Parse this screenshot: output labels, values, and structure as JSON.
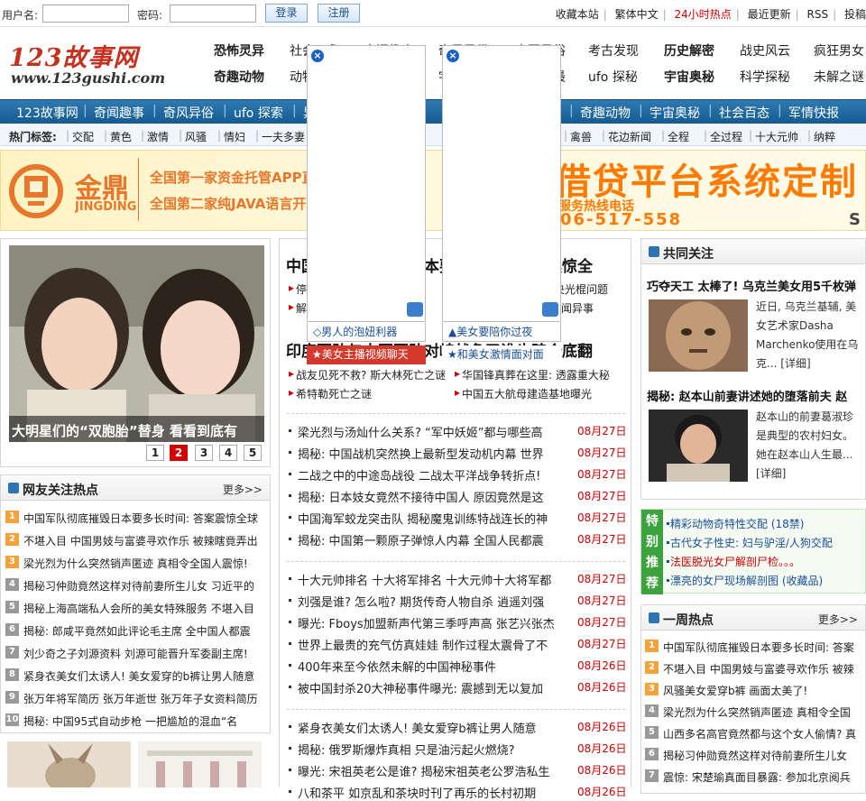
{
  "top": {
    "username_label": "用户名:",
    "password_label": "密码:",
    "login_button": "登录",
    "register_button": "注册",
    "links": [
      "收藏本站",
      "繁体中文",
      "24小时热点",
      "最近更新",
      "RSS",
      "投稿"
    ],
    "accent": "#cc0000"
  },
  "logo": {
    "name": "123故事网",
    "url": "www.123gushi.com"
  },
  "categories": {
    "row1": [
      "恐怖灵异",
      "社会万象",
      "奇闻趣事",
      "奇风异俗",
      "中国风俗",
      "考古发现",
      "历史解密",
      "战史风云",
      "疯狂男女"
    ],
    "row2": [
      "奇趣动物",
      "动物世界",
      "人物传奇",
      "宇宙之谜",
      "世界之最",
      "ufo 探秘",
      "宇宙奥秘",
      "科学探秘",
      "未解之谜"
    ]
  },
  "nav": [
    "123故事网",
    "奇闻趣事",
    "奇风异俗",
    "ufo 探索",
    "异国风情",
    "奇趣动物",
    "宇宙奥秘",
    "社会百态",
    "军情快报"
  ],
  "tags": {
    "label": "热门标签:",
    "items": [
      "交配",
      "黄色",
      "激情",
      "风骚",
      "情妇",
      "一夫多妻",
      "禽兽",
      "花边新闻",
      "全程",
      "全过程",
      "十大元帅",
      "纳粹"
    ]
  },
  "banner": {
    "brand_cn": "金鼎",
    "brand_en": "JINGDING",
    "line1": "全国第一家资金托管APP直接交易",
    "line2": "全国第二家纯JAVA语言开发系统",
    "headline": "借贷平台系统定制",
    "hotline_label": "服务热线电话",
    "phone": "06-517-558",
    "corner": "S",
    "colors": {
      "orange": "#ff7a00",
      "red": "#e52b1f"
    }
  },
  "slideshow": {
    "caption": "大明星们的“双胞胎”替身  看看到底有",
    "pages": [
      "1",
      "2",
      "3",
      "4",
      "5"
    ],
    "active_page": "2"
  },
  "netizen": {
    "title": "网友关注热点",
    "more": "更多>>",
    "items": [
      "中国军队彻底摧毁日本要多长时间: 答案震惊全球",
      "不堪入目  中国男妓与富婆寻欢作乐  被辣瞎竟弄出",
      "梁光烈为什么突然销声匿迹  真相令全国人震惊!",
      "揭秘习仲勋竟然这样对待前妻所生儿女  习近平的",
      "揭秘上海高端私人会所的美女特殊服务  不堪入目",
      "揭秘: 郎咸平竟然如此评论毛主席  全中国人都震",
      "刘少奇之子刘源资料  刘源可能晋升军委副主席!",
      "紧身衣美女们太诱人!  美女爱穿的b裤让男人随意",
      "张万年将军简历  张万年逝世  张万年子女资料简历",
      "揭秘: 中国95式自动步枪  一把尴尬的混血“名"
    ]
  },
  "center": {
    "headline1": "中国军队彻底摧毁日本要多长时间答案震惊全",
    "sub1": [
      [
        "停",
        "宣布破产,秘密"
      ],
      [
        "解",
        "惊天奇闻异事"
      ]
    ],
    "sub1_right": [
      "央光棍问题",
      "闻异事"
    ],
    "headline2": "印度军队与中国军队对峙战争了谁也赔个底翻",
    "sub2": [
      "战友见死不救? 斯大林死亡之谜",
      "华国锋真葬在这里: 透露重大秘",
      "希特勒死亡之谜",
      "中国五大航母建造基地曝光"
    ],
    "group1": [
      {
        "t": "梁光烈与汤灿什么关系?  “军中妖姬”都与哪些高",
        "d": "08月27日"
      },
      {
        "t": "揭秘: 中国战机突然换上最新型发动机内幕  世界",
        "d": "08月27日"
      },
      {
        "t": "二战之中的中途岛战役  二战太平洋战争转折点!",
        "d": "08月27日"
      },
      {
        "t": "揭秘: 日本妓女竟然不接待中国人  原因竟然是这",
        "d": "08月27日"
      },
      {
        "t": "中国海军蛟龙突击队  揭秘魔鬼训练特战连长的神",
        "d": "08月27日"
      },
      {
        "t": "揭秘: 中国第一颗原子弹惊人内幕  全国人民都震",
        "d": "08月27日"
      }
    ],
    "group2": [
      {
        "t": "十大元帅排名  十大将军排名  十大元帅十大将军都",
        "d": "08月27日"
      },
      {
        "t": "刘强是谁? 怎么啦? 期货传奇人物自杀  逍遥刘强",
        "d": "08月27日"
      },
      {
        "t": "曝光: Fboys加盟新声代第三季呼声高  张艺兴张杰",
        "d": "08月27日"
      },
      {
        "t": "世界上最贵的充气仿真娃娃  制作过程太震骨了不",
        "d": "08月27日"
      },
      {
        "t": "400年来至今依然未解的中国神秘事件",
        "d": "08月26日"
      },
      {
        "t": "被中国封杀20大神秘事件曝光: 震撼到无以复加",
        "d": "08月26日"
      }
    ],
    "group3": [
      {
        "t": "紧身衣美女们太诱人!  美女爱穿b裤让男人随意",
        "d": "08月26日"
      },
      {
        "t": "揭秘: 俄罗斯爆炸真相  只是油污起火燃烧?",
        "d": "08月26日"
      },
      {
        "t": "曝光: 宋祖英老公是谁? 揭秘宋祖英老公罗浩私生",
        "d": "08月26日"
      },
      {
        "t": "八和茶平  如京乱和茶块时刊了再乐的长村初期",
        "d": "08月26日"
      }
    ]
  },
  "popups": [
    {
      "link1": "◇男人的泡妞利器",
      "link2": "★美女主播视频聊天"
    },
    {
      "link1": "▲美女要陪你过夜",
      "link2": "★和美女激情面对面"
    }
  ],
  "right": {
    "title": "共同关注",
    "article1": {
      "title": "巧夺天工 太棒了! 乌克兰美女用5千枚弹",
      "desc": "近日, 乌克兰基辅, 美女艺术家Dasha Marchenko使用在乌克...",
      "detail": "[详细]"
    },
    "article2": {
      "title": "揭秘: 赵本山前妻讲述她的堕落前夫 赵",
      "desc": "赵本山的前妻葛淑珍是典型的农村妇女。她在赵本山人生最...",
      "detail": "[详细]"
    },
    "special": {
      "tag": "特别推荐",
      "items": [
        {
          "t": "精彩动物奇特性交配 (18禁)",
          "red": false
        },
        {
          "t": "古代女子性史: 妇与驴淫/人狗交配",
          "red": false
        },
        {
          "t": "法医脱光女尸解剖尸检。。。",
          "red": true
        },
        {
          "t": "漂亮的女尸现场解剖图 (收藏品)",
          "red": false
        }
      ]
    },
    "weekly": {
      "title": "一周热点",
      "more": "更多>>",
      "items": [
        "中国军队彻底摧毁日本要多长时间: 答案",
        "不堪入目  中国男妓与富婆寻欢作乐  被辣",
        "风骚美女爱穿b裤  画面太美了!",
        "梁光烈为什么突然销声匿迹  真相令全国",
        "山西多名高官竟然都与这个女人偷情? 真",
        "揭秘习仲勋竟然这样对待前妻所生儿女",
        "震惊: 宋楚瑜真面目暴露: 参加北京阅兵"
      ]
    }
  }
}
